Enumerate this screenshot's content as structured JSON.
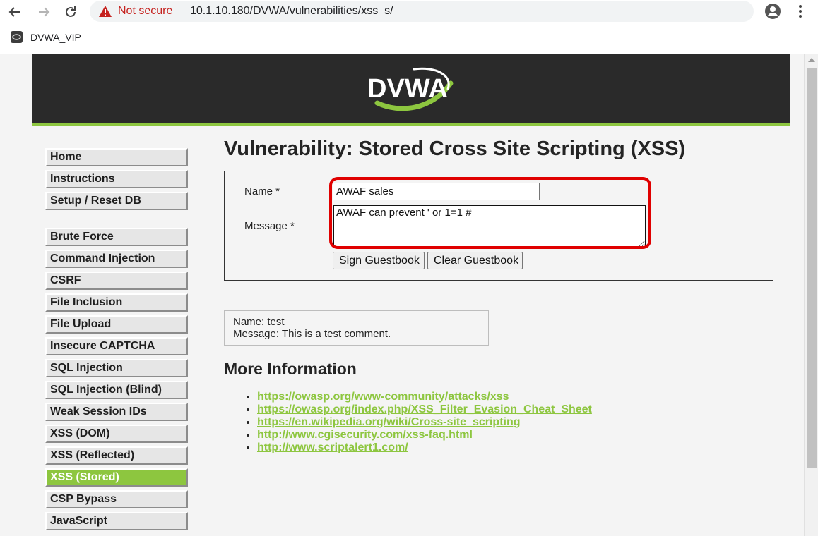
{
  "browser": {
    "security_label": "Not secure",
    "url": "10.1.10.180/DVWA/vulnerabilities/xss_s/",
    "bookmark_label": "DVWA_VIP"
  },
  "header": {
    "logo_text": "DVWA"
  },
  "menu": {
    "items": [
      "Home",
      "Instructions",
      "Setup / Reset DB",
      "Brute Force",
      "Command Injection",
      "CSRF",
      "File Inclusion",
      "File Upload",
      "Insecure CAPTCHA",
      "SQL Injection",
      "SQL Injection (Blind)",
      "Weak Session IDs",
      "XSS (DOM)",
      "XSS (Reflected)",
      "XSS (Stored)",
      "CSP Bypass",
      "JavaScript"
    ],
    "active": "XSS (Stored)"
  },
  "main": {
    "title": "Vulnerability: Stored Cross Site Scripting (XSS)",
    "form": {
      "name_label": "Name *",
      "message_label": "Message *",
      "name_value": "AWAF sales",
      "message_value": "AWAF can prevent ' or 1=1 #",
      "sign_button": "Sign Guestbook",
      "clear_button": "Clear Guestbook"
    },
    "comment": {
      "name_line": "Name: test",
      "message_line": "Message: This is a test comment."
    },
    "more_info_title": "More Information",
    "links": [
      "https://owasp.org/www-community/attacks/xss",
      "https://owasp.org/index.php/XSS_Filter_Evasion_Cheat_Sheet",
      "https://en.wikipedia.org/wiki/Cross-site_scripting",
      "http://www.cgisecurity.com/xss-faq.html",
      "http://www.scriptalert1.com/"
    ]
  },
  "colors": {
    "accent": "#8dc63f",
    "header_bg": "#2a2a2a",
    "highlight": "#e00000",
    "warning": "#c5221f"
  }
}
